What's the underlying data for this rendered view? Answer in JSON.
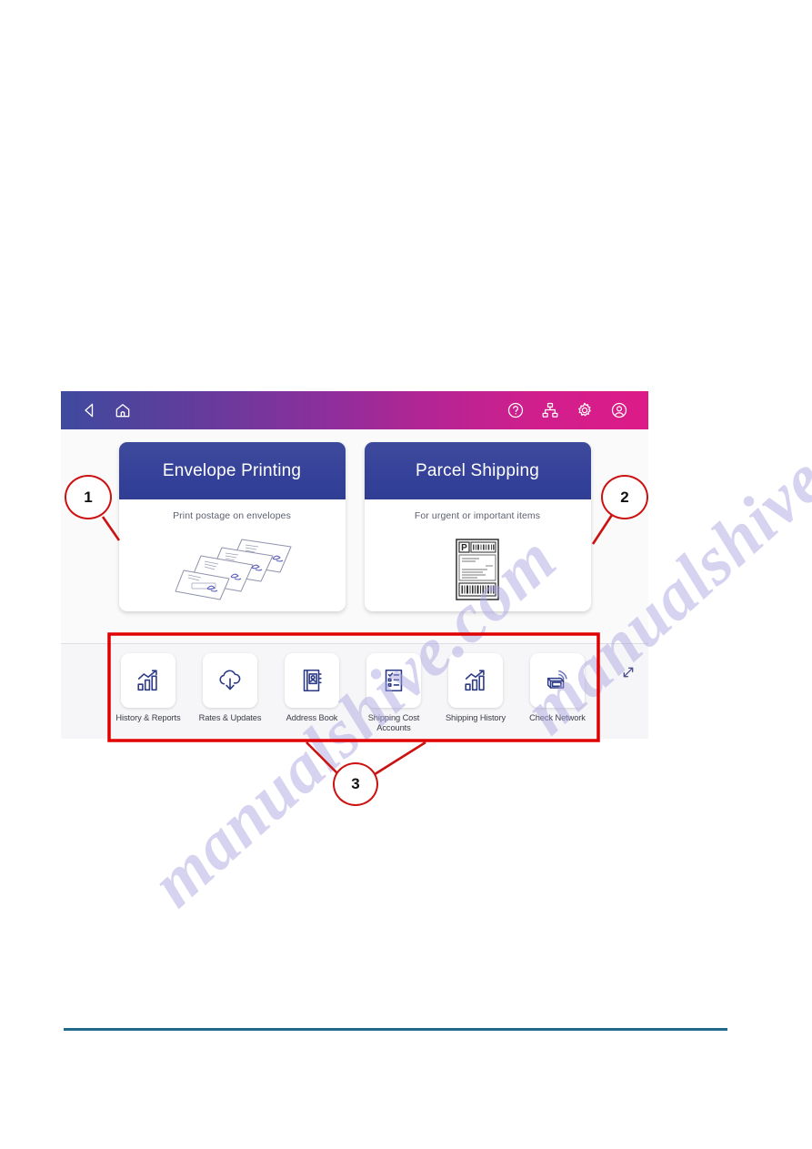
{
  "watermark": {
    "text": "manualshive.com"
  },
  "device_screen": {
    "app_bar": {
      "left_icons": [
        {
          "name": "back-icon",
          "label": "Back"
        },
        {
          "name": "home-icon",
          "label": "Home"
        }
      ],
      "right_icons": [
        {
          "name": "help-icon",
          "label": "Help"
        },
        {
          "name": "network-icon",
          "label": "Network"
        },
        {
          "name": "settings-gear-icon",
          "label": "Settings"
        },
        {
          "name": "user-account-icon",
          "label": "Account"
        }
      ],
      "gradient_from": "#3f4a9e",
      "gradient_to": "#dd1b87"
    },
    "hero_cards": [
      {
        "title": "Envelope Printing",
        "subtitle": "Print postage on envelopes",
        "art": "envelope-stack-illustration",
        "header_color": "#36429a"
      },
      {
        "title": "Parcel Shipping",
        "subtitle": "For urgent or important items",
        "art": "shipping-label-illustration",
        "header_color": "#36429a"
      }
    ],
    "shortcuts": [
      {
        "label": "History & Reports",
        "icon": "bar-chart-trend-icon"
      },
      {
        "label": "Rates & Updates",
        "icon": "cloud-download-icon"
      },
      {
        "label": "Address Book",
        "icon": "address-book-icon"
      },
      {
        "label": "Shipping Cost Accounts",
        "icon": "checklist-icon"
      },
      {
        "label": "Shipping History",
        "icon": "bar-chart-trend-icon"
      },
      {
        "label": "Check Network",
        "icon": "network-device-icon"
      }
    ],
    "expand_button": {
      "icon": "expand-diagonal-icon",
      "label": "Expand"
    }
  },
  "annotations": {
    "callouts": [
      {
        "number": "1",
        "target": "envelope-printing-card",
        "color": "#cc1111"
      },
      {
        "number": "2",
        "target": "parcel-shipping-card",
        "color": "#cc1111"
      },
      {
        "number": "3",
        "target": "shortcuts-row",
        "color": "#cc1111"
      }
    ],
    "highlight_box": {
      "target": "shortcuts-row",
      "color": "#e00000"
    }
  },
  "footer": {
    "rule_color": "#216a8c"
  }
}
